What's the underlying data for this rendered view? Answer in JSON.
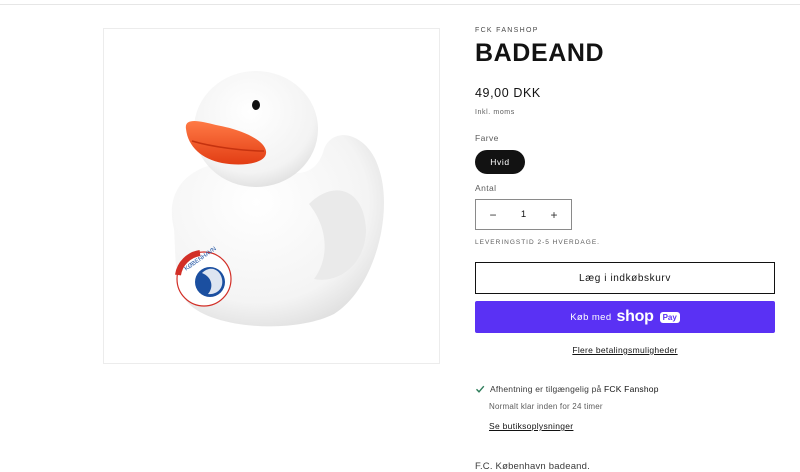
{
  "media": {
    "image_description_icon": "rubber-duck-with-fck-logo",
    "logo_text": "F.C. KØBENHAVN"
  },
  "product": {
    "vendor": "FCK FANSHOP",
    "title": "BADEAND",
    "price": "49,00 DKK",
    "tax_note": "Inkl. moms",
    "color_label": "Farve",
    "color_selected": "Hvid",
    "quantity_label": "Antal",
    "quantity_minus": "−",
    "quantity_value": "1",
    "quantity_plus": "+",
    "lead_time": "LEVERINGSTID 2-5 HVERDAGE.",
    "add_to_cart": "Læg i indkøbskurv",
    "shop_pay": {
      "prefix": "Køb med",
      "brand": "shop",
      "badge": "Pay"
    },
    "more_payment": "Flere betalingsmuligheder"
  },
  "pickup": {
    "icon": "check-icon",
    "text_prefix": "Afhentning er tilgængelig på",
    "store": "FCK Fanshop",
    "ready": "Normalt klar inden for 24 timer",
    "store_link": "Se butiksoplysninger"
  },
  "description": "F.C. København badeand.",
  "colors": {
    "shop_pay": "#5a31f4",
    "pill": "#121212",
    "check": "#2e7d5b",
    "beak": "#f04e23"
  }
}
